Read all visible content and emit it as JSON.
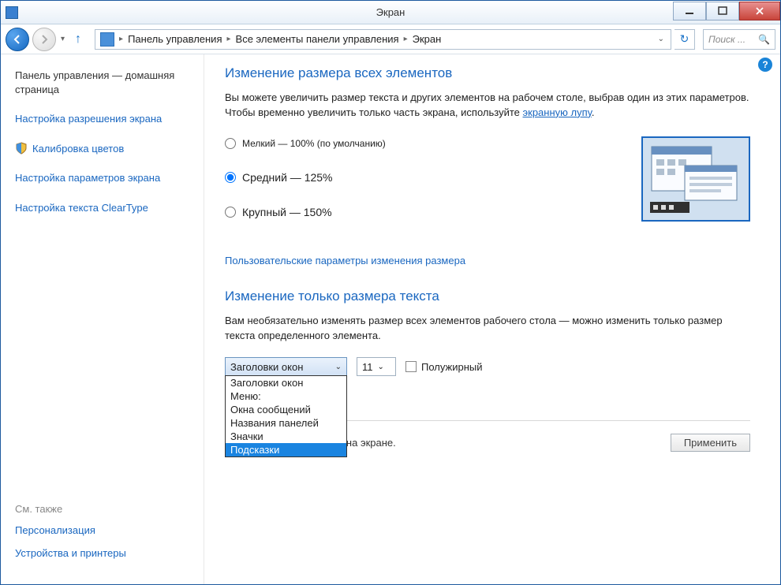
{
  "titlebar": {
    "title": "Экран"
  },
  "nav": {
    "crumb1": "Панель управления",
    "crumb2": "Все элементы панели управления",
    "crumb3": "Экран",
    "search_placeholder": "Поиск ..."
  },
  "sidebar": {
    "home": "Панель управления — домашняя страница",
    "links": [
      "Настройка разрешения экрана",
      "Калибровка цветов",
      "Настройка параметров экрана",
      "Настройка текста ClearType"
    ],
    "see_also": "См. также",
    "see_links": [
      "Персонализация",
      "Устройства и принтеры"
    ]
  },
  "main": {
    "h1": "Изменение размера всех элементов",
    "desc_pre": "Вы можете увеличить размер текста и других элементов на рабочем столе, выбрав один из этих параметров. Чтобы временно увеличить только часть экрана, используйте ",
    "desc_link": "экранную лупу",
    "radios": {
      "small": "Мелкий — 100% (по умолчанию)",
      "medium": "Средний — 125%",
      "large": "Крупный — 150%"
    },
    "custom_link": "Пользовательские параметры изменения размера",
    "h2": "Изменение только размера текста",
    "desc2": "Вам необязательно изменять размер всех элементов рабочего стола — можно изменить только размер текста определенного элемента.",
    "combo_value": "Заголовки окон",
    "size_value": "11",
    "bold_label": "Полужирный",
    "dropdown_options": [
      "Заголовки окон",
      "Меню:",
      "Окна сообщений",
      "Названия панелей",
      "Значки",
      "Подсказки"
    ],
    "footer_note": "ты могут не поместиться на экране.",
    "apply": "Применить"
  }
}
